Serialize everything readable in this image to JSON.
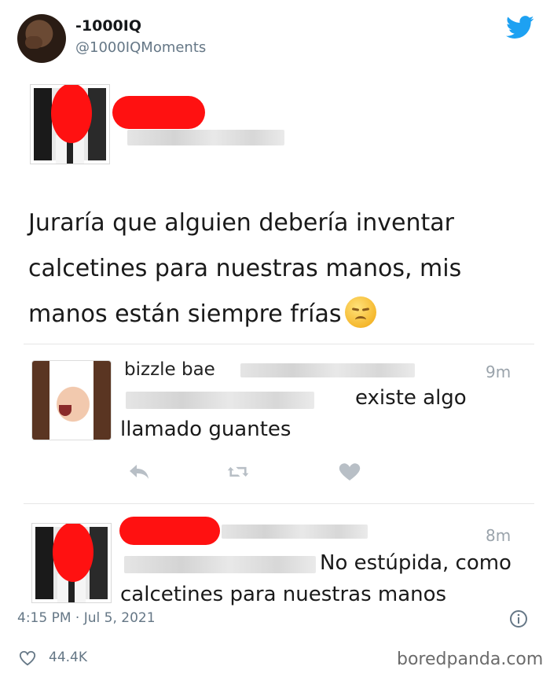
{
  "author": {
    "name": "-1000IQ",
    "handle": "@1000IQMoments"
  },
  "screenshot": {
    "original_post": {
      "text": "Juraría que alguien debería inventar calcetines para nuestras manos, mis manos están siempre frías"
    },
    "replies": [
      {
        "name": "bizzle bae",
        "time": "9m",
        "text_line1": "existe algo",
        "text_line2": "llamado guantes"
      },
      {
        "time": "8m",
        "text_line1": "No estúpida, como",
        "text_line2": "calcetines para nuestras manos"
      }
    ]
  },
  "footer": {
    "timestamp": "4:15 PM · Jul 5, 2021",
    "likes": "44.4K",
    "watermark": "boredpanda.com"
  },
  "colors": {
    "twitter_blue": "#1da1f2",
    "redaction_red": "#ff1111",
    "muted_text": "#657786"
  }
}
